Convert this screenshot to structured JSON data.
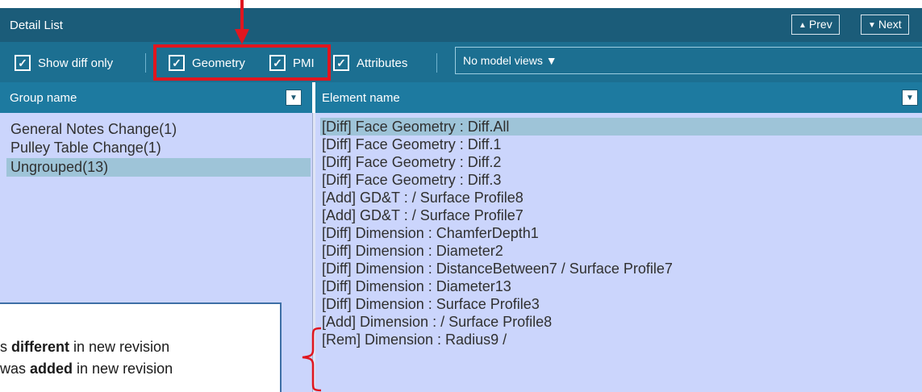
{
  "header": {
    "title": "Detail List",
    "prev_label": "Prev",
    "next_label": "Next",
    "prev_arrow": "▲",
    "next_arrow": "▼"
  },
  "toolbar": {
    "show_diff_only": {
      "label": "Show diff only",
      "checked": true
    },
    "geometry": {
      "label": "Geometry",
      "checked": true
    },
    "pmi": {
      "label": "PMI",
      "checked": true
    },
    "attributes": {
      "label": "Attributes",
      "checked": true
    },
    "model_views": "No model views ▼",
    "check_glyph": "✓"
  },
  "groups_panel": {
    "header": "Group name",
    "items": [
      {
        "label": "General Notes Change(1)",
        "selected": false
      },
      {
        "label": "Pulley Table Change(1)",
        "selected": false
      },
      {
        "label": "Ungrouped(13)",
        "selected": true
      }
    ]
  },
  "elements_panel": {
    "header": "Element name",
    "items": [
      "[Diff] Face Geometry : Diff.All",
      "[Diff] Face Geometry : Diff.1",
      "[Diff] Face Geometry : Diff.2",
      "[Diff] Face Geometry : Diff.3",
      "[Add] GD&T :  / Surface Profile8",
      "[Add] GD&T :  / Surface Profile7",
      "[Diff] Dimension : ChamferDepth1",
      "[Diff] Dimension : Diameter2",
      "[Diff] Dimension : DistanceBetween7 / Surface Profile7",
      "[Diff] Dimension : Diameter13",
      "[Diff] Dimension : Surface Profile3",
      "[Add] Dimension :  / Surface Profile8",
      "[Rem] Dimension : Radius9 /"
    ]
  },
  "filter_glyph": "▼",
  "callout": {
    "line1_pre": "s ",
    "line1_bold": "different",
    "line1_post": " in new revision",
    "line2_pre": "was ",
    "line2_bold": "added",
    "line2_post": " in new revision"
  },
  "colors": {
    "titlebar": "#1b5c79",
    "toolbar": "#1c6f91",
    "column_header": "#1d7aa0",
    "list_background": "#cbd5fc",
    "selected_row": "#9ec4d8",
    "annotation_red": "#e0161f"
  }
}
